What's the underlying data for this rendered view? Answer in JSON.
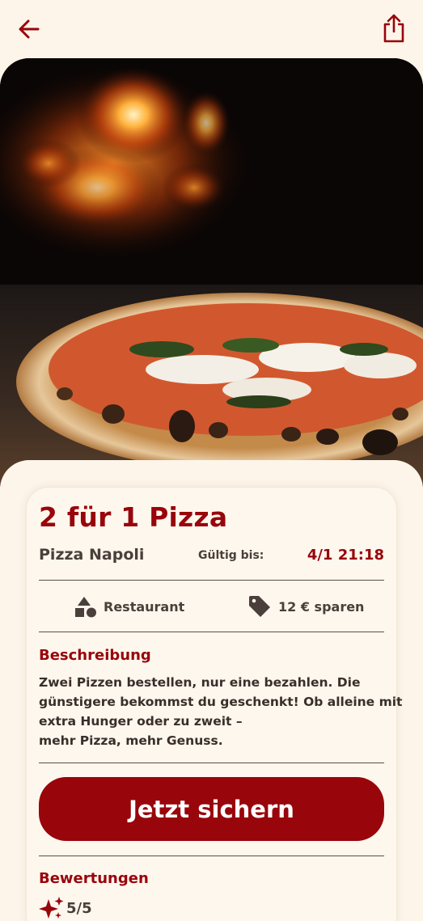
{
  "header": {
    "back_icon": "arrow-left-icon",
    "share_icon": "share-icon"
  },
  "hero": {
    "image": "pizza-margherita-photo"
  },
  "deal": {
    "title": "2 für 1 Pizza",
    "merchant": "Pizza Napoli",
    "valid_label": "Gültig bis:",
    "valid_value": "4/1 21:18",
    "category": "Restaurant",
    "category_icon": "shapes-icon",
    "savings": "12 € sparen",
    "savings_icon": "price-tag-icon"
  },
  "description": {
    "heading": "Beschreibung",
    "lines": [
      "Zwei Pizzen bestellen, nur eine bezahlen. Die",
      "günstigere bekommst du geschenkt! Ob alleine mit",
      "extra Hunger oder zu zweit –",
      "mehr Pizza, mehr Genuss."
    ]
  },
  "cta": {
    "label": "Jetzt sichern"
  },
  "reviews": {
    "heading": "Bewertungen",
    "rating": "5/5",
    "rating_icon": "sparkles-icon"
  },
  "colors": {
    "accent": "#98050b",
    "background": "#fdf5ea",
    "text": "#3a2e2a"
  }
}
